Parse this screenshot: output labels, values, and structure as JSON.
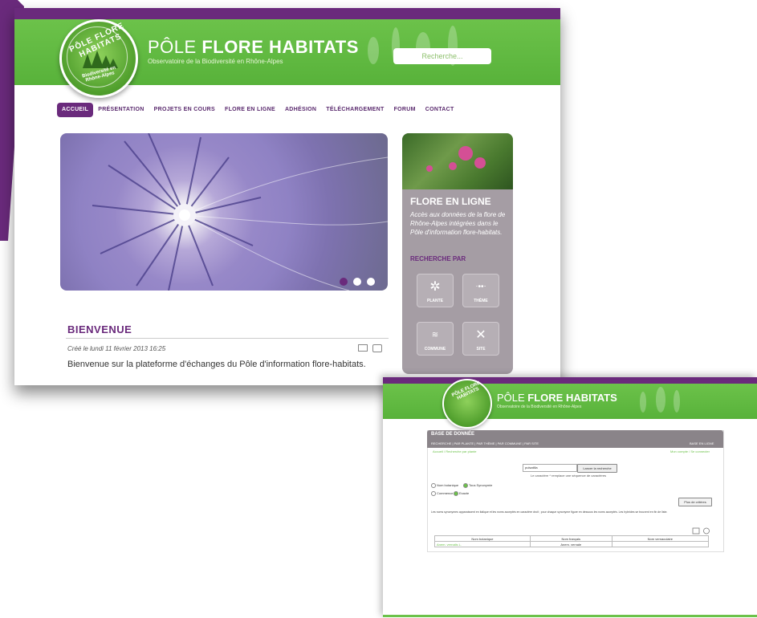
{
  "main_site": {
    "logo": {
      "arc_text": "PÔLE FLORE HABITATS",
      "bottom_text": "Biodiversité en Rhône-Alpes"
    },
    "title_light": "PÔLE ",
    "title_bold": "FLORE HABITATS",
    "subtitle": "Observatoire de la Biodiversité en Rhône-Alpes",
    "search_placeholder": "Recherche...",
    "nav": [
      "ACCUEIL",
      "PRÉSENTATION",
      "PROJETS EN COURS",
      "FLORE EN LIGNE",
      "ADHÉSION",
      "TÉLÉCHARGEMENT",
      "FORUM",
      "CONTACT"
    ],
    "bienvenue": {
      "title": "BIENVENUE",
      "date": "Créé le lundi 11 février 2013 16:25",
      "text": "Bienvenue sur la plateforme d'échanges du Pôle d'information flore-habitats."
    },
    "side": {
      "title": "FLORE EN LIGNE",
      "text": "Accès aux données de la flore de Rhône-Alpes intégrées dans le Pôle d'information flore-habitats.",
      "search_label": "RECHERCHE PAR",
      "tiles": [
        "PLANTE",
        "THÈME",
        "COMMUNE",
        "SITE"
      ]
    },
    "colors": {
      "green": "#6cc24a",
      "purple": "#6a2a7c",
      "panel": "#a59da4"
    }
  },
  "second_site": {
    "title_light": "PÔLE ",
    "title_bold": "FLORE HABITATS",
    "subtitle": "Observatoire de la Biodiversité en Rhône-Alpes",
    "bar_title": "BASE DE DONNÉE",
    "bar_nav": "RECHERCHE  |  PAR PLANTE  |  PAR THÈME  |  PAR COMMUNE  |  PAR SITE",
    "bar_right": "BASE EN LIGNE",
    "breadcrumb": "Accueil / Recherche par plante",
    "breadcrumb_right": "Mon compte / Se connecter",
    "input_value": "pulsatilla",
    "search_button": "Lancer la recherche",
    "hint": "Le caractère * remplace une séquence de caractères",
    "radios": [
      {
        "label": "Nom botanique",
        "checked": false
      },
      {
        "label": "Tous Synonymie",
        "checked": true
      },
      {
        "label": "Commence",
        "checked": false
      },
      {
        "label": "Exacte",
        "checked": true
      }
    ],
    "criteria_button": "Plus de critères",
    "paragraph": "Les noms synonymes apparaissent en italique et les noms acceptés en caractère droit ; pour chaque synonyme figure en dessous les noms acceptés. Les hybrides se trouvent en fin de liste.",
    "table": {
      "headers": [
        "Nom botanique",
        "Nom français",
        "Nom vernaculaire"
      ],
      "row": [
        "Anem. vernalis L.",
        "Anem. vernale",
        ""
      ]
    }
  }
}
